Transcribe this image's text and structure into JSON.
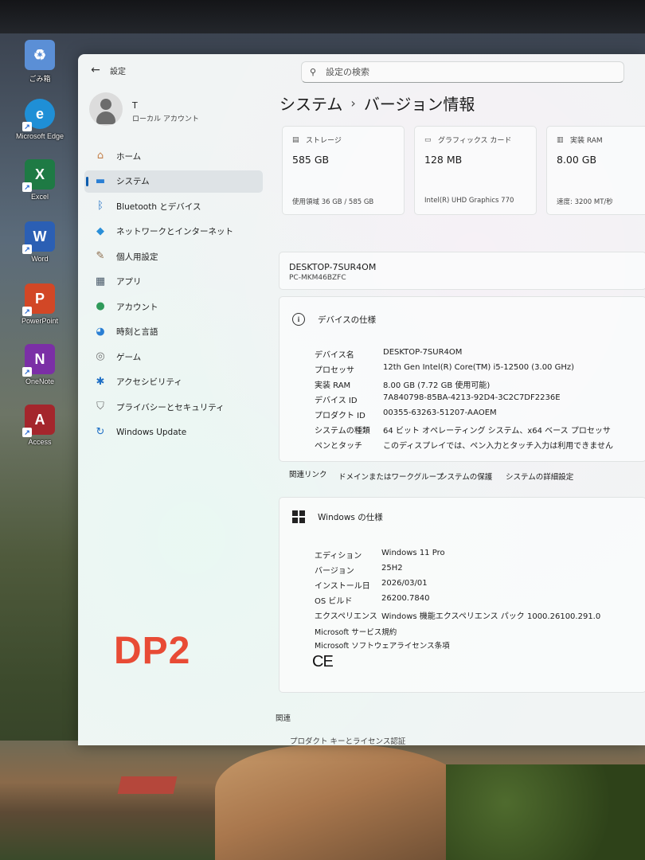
{
  "desktop": {
    "icons": [
      {
        "label": "ごみ箱",
        "name": "recycle-bin-icon",
        "glyph": "♻",
        "color": "#5b8fd6"
      },
      {
        "label": "Microsoft Edge",
        "name": "edge-icon",
        "glyph": "e",
        "color": "#1f8fd6"
      },
      {
        "label": "Excel",
        "name": "excel-icon",
        "glyph": "X",
        "color": "#1e7a44"
      },
      {
        "label": "Word",
        "name": "word-icon",
        "glyph": "W",
        "color": "#2b5fb4"
      },
      {
        "label": "PowerPoint",
        "name": "powerpoint-icon",
        "glyph": "P",
        "color": "#d24726"
      },
      {
        "label": "OneNote",
        "name": "onenote-icon",
        "glyph": "N",
        "color": "#7b2fa6"
      },
      {
        "label": "Access",
        "name": "access-icon",
        "glyph": "A",
        "color": "#a4262c"
      }
    ]
  },
  "window": {
    "app_title": "設定",
    "search_placeholder": "設定の検索"
  },
  "profile": {
    "name": "T",
    "account_type": "ローカル アカウント"
  },
  "sidebar": {
    "items": [
      {
        "label": "ホーム",
        "icon": "home-icon",
        "glyph": "⌂",
        "color": "#c4804a"
      },
      {
        "label": "システム",
        "icon": "system-icon",
        "glyph": "▬",
        "color": "#2a7fd4"
      },
      {
        "label": "Bluetooth とデバイス",
        "icon": "bluetooth-icon",
        "glyph": "ᛒ",
        "color": "#1f6fc5"
      },
      {
        "label": "ネットワークとインターネット",
        "icon": "network-icon",
        "glyph": "◆",
        "color": "#2a8fd8"
      },
      {
        "label": "個人用設定",
        "icon": "personalization-icon",
        "glyph": "✎",
        "color": "#8a6a4a"
      },
      {
        "label": "アプリ",
        "icon": "apps-icon",
        "glyph": "▦",
        "color": "#4a5a6a"
      },
      {
        "label": "アカウント",
        "icon": "accounts-icon",
        "glyph": "●",
        "color": "#2f9a5a"
      },
      {
        "label": "時刻と言語",
        "icon": "time-language-icon",
        "glyph": "◕",
        "color": "#2a7fd4"
      },
      {
        "label": "ゲーム",
        "icon": "gaming-icon",
        "glyph": "◎",
        "color": "#707070"
      },
      {
        "label": "アクセシビリティ",
        "icon": "accessibility-icon",
        "glyph": "✱",
        "color": "#1f6fc5"
      },
      {
        "label": "プライバシーとセキュリティ",
        "icon": "privacy-shield-icon",
        "glyph": "⛉",
        "color": "#6a6a6a"
      },
      {
        "label": "Windows Update",
        "icon": "windows-update-icon",
        "glyph": "↻",
        "color": "#1f6fc5"
      }
    ],
    "active_index": 1
  },
  "breadcrumb": {
    "parent": "システム",
    "separator": "›",
    "current": "バージョン情報"
  },
  "stats": [
    {
      "label": "ストレージ",
      "icon": "storage-icon",
      "value": "585 GB",
      "detail": "使用領域 36 GB / 585 GB"
    },
    {
      "label": "グラフィックス カード",
      "icon": "graphics-card-icon",
      "value": "128 MB",
      "detail": "Intel(R) UHD Graphics 770"
    },
    {
      "label": "実装 RAM",
      "icon": "ram-icon",
      "value": "8.00 GB",
      "detail": "速度: 3200 MT/秒"
    }
  ],
  "device": {
    "name": "DESKTOP-7SUR4OM",
    "model": "PC-MKM46BZFC"
  },
  "device_specs": {
    "title": "デバイスの仕様",
    "rows": [
      {
        "label": "デバイス名",
        "value": "DESKTOP-7SUR4OM"
      },
      {
        "label": "プロセッサ",
        "value": "12th Gen Intel(R) Core(TM) i5-12500 (3.00 GHz)"
      },
      {
        "label": "実装 RAM",
        "value": "8.00 GB (7.72 GB 使用可能)"
      },
      {
        "label": "デバイス ID",
        "value": "7A840798-85BA-4213-92D4-3C2C7DF2236E"
      },
      {
        "label": "プロダクト ID",
        "value": "00355-63263-51207-AAOEM"
      },
      {
        "label": "システムの種類",
        "value": "64 ビット オペレーティング システム、x64 ベース プロセッサ"
      },
      {
        "label": "ペンとタッチ",
        "value": "このディスプレイでは、ペン入力とタッチ入力は利用できません"
      }
    ]
  },
  "related_links": {
    "title": "関連リンク",
    "links": [
      "ドメインまたはワークグループ",
      "システムの保護",
      "システムの詳細設定"
    ]
  },
  "windows_specs": {
    "title": "Windows の仕様",
    "rows": [
      {
        "label": "エディション",
        "value": "Windows 11 Pro"
      },
      {
        "label": "バージョン",
        "value": "25H2"
      },
      {
        "label": "インストール日",
        "value": "2026/03/01"
      },
      {
        "label": "OS ビルド",
        "value": "26200.7840"
      },
      {
        "label": "エクスペリエンス",
        "value": "Windows 機能エクスペリエンス パック 1000.26100.291.0"
      }
    ],
    "links": [
      "Microsoft サービス規約",
      "Microsoft ソフトウェアライセンス条項"
    ],
    "ce_mark": "CE"
  },
  "related": {
    "title": "関連",
    "first_item": "プロダクト キーとライセンス認証"
  },
  "overlay": {
    "watermark": "DP2",
    "watermark_color": "#e84b35"
  }
}
